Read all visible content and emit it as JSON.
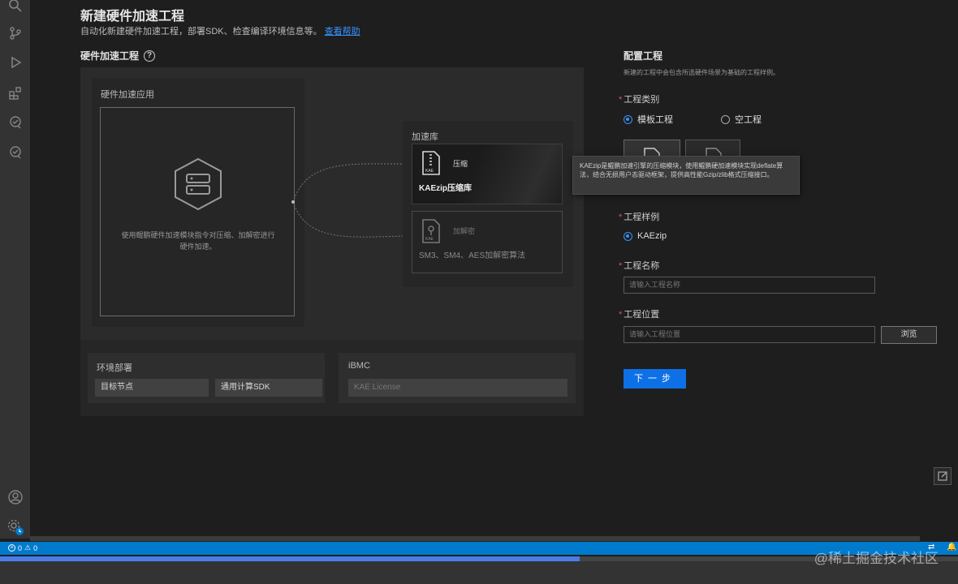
{
  "header": {
    "title": "新建硬件加速工程",
    "subtitle": "自动化新建硬件加速工程，部署SDK、检查编译环境信息等。",
    "help_link": "查看帮助"
  },
  "hw_section": {
    "title": "硬件加速工程",
    "help_glyph": "?",
    "app_card": {
      "label": "硬件加速应用",
      "desc": "使用鲲鹏硬件加速模块指令对压缩、加解密进行硬件加速。"
    },
    "accel_lib": {
      "label": "加速库",
      "items": [
        {
          "tag": "压缩",
          "name": "KAEzip压缩库",
          "icon_label": "KAE"
        },
        {
          "tag": "加解密",
          "name": "SM3、SM4、AES加解密算法",
          "icon_label": "KAE"
        }
      ]
    },
    "env": {
      "label": "环境部署",
      "buttons": [
        "目标节点",
        "通用计算SDK"
      ]
    },
    "ibmc": {
      "label": "iBMC",
      "button": "KAE License"
    }
  },
  "config": {
    "title": "配置工程",
    "desc": "新建的工程中会包含所选硬件场景为基础的工程样例。",
    "project_type": {
      "label": "工程类别",
      "options": [
        {
          "label": "模板工程",
          "selected": true
        },
        {
          "label": "空工程",
          "selected": false
        }
      ]
    },
    "tooltip": "KAEzip是鲲鹏加速引擎的压缩模块，使用鲲鹏硬加速模块实现deflate算法，结合无损用户态驱动框架，提供高性能Gzip/zlib格式压缩接口。",
    "sample": {
      "label": "工程样例",
      "options": [
        {
          "label": "KAEzip",
          "selected": true
        }
      ]
    },
    "name_field": {
      "label": "工程名称",
      "placeholder": "请输入工程名称"
    },
    "location_field": {
      "label": "工程位置",
      "placeholder": "请输入工程位置"
    },
    "browse_button": "浏览",
    "next_button": "下一步"
  },
  "statusbar": {
    "errors": "0",
    "warnings": "0"
  },
  "watermark": "@稀土掘金技术社区",
  "progress": 0.605,
  "colors": {
    "accent": "#0e70e6",
    "link": "#3794ff",
    "statusbar": "#007acc",
    "required": "#e05252"
  }
}
